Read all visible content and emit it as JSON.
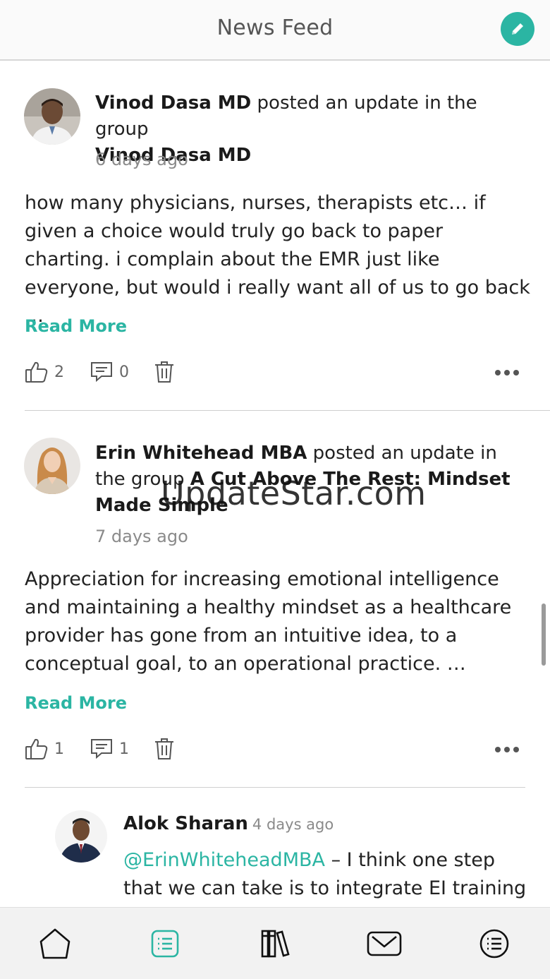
{
  "header": {
    "title": "News Feed",
    "compose_icon": "pencil-icon"
  },
  "posts": [
    {
      "author": "Vinod Dasa MD",
      "action": " posted an update in the group",
      "group": "Vinod Dasa MD",
      "time": "6 days ago",
      "body": "how many physicians, nurses, therapists etc… if given a choice would truly go back to paper charting. i complain about the EMR just like everyone, but would i really want all of us to go back …",
      "read_more": "Read More",
      "likes": "2",
      "comments": "0"
    },
    {
      "author": "Erin Whitehead MBA",
      "action": " posted an update in the group ",
      "group": "A Cut Above The Rest: Mindset Made Simple",
      "time": "7 days ago",
      "body": "Appreciation for increasing emotional intelligence and maintaining a healthy mindset as a healthcare provider has gone from an intuitive idea, to a conceptual goal, to an operational practice. …",
      "read_more": "Read More",
      "likes": "1",
      "comments": "1"
    }
  ],
  "comment": {
    "author": "Alok Sharan",
    "time": "4 days ago",
    "mention": "@ErinWhiteheadMBA",
    "text": " – I think one step that we can take is to integrate EI training"
  },
  "watermark": "UpdateStar.com",
  "tabbar": {
    "tabs": [
      {
        "name": "home",
        "icon": "home-icon"
      },
      {
        "name": "feed",
        "icon": "activity-feed-icon",
        "active": true
      },
      {
        "name": "library",
        "icon": "library-icon"
      },
      {
        "name": "messages",
        "icon": "mail-icon"
      },
      {
        "name": "menu",
        "icon": "menu-list-icon"
      }
    ]
  },
  "colors": {
    "accent": "#2bb5a3",
    "text": "#222222",
    "muted": "#8a8a8a"
  }
}
